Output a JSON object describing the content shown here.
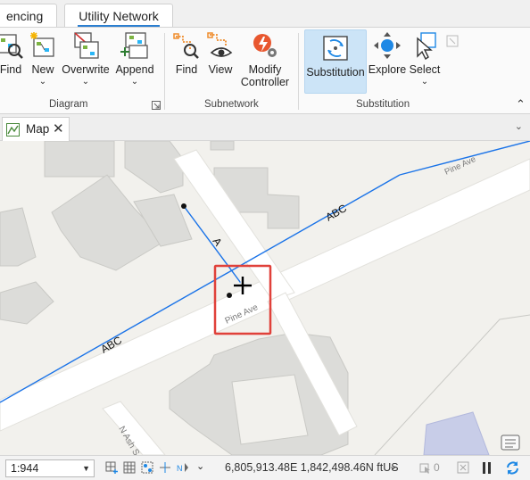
{
  "ribbon": {
    "tabs": [
      {
        "label": "encing"
      },
      {
        "label": "Utility Network"
      }
    ],
    "groups": {
      "diagram": {
        "label": "Diagram",
        "buttons": [
          {
            "label": "Find",
            "icon": "diagram-find-icon"
          },
          {
            "label": "New",
            "icon": "diagram-new-icon",
            "has_dropdown": true
          },
          {
            "label": "Overwrite",
            "icon": "diagram-overwrite-icon",
            "has_dropdown": true
          },
          {
            "label": "Append",
            "icon": "diagram-append-icon",
            "has_dropdown": true
          }
        ]
      },
      "subnetwork": {
        "label": "Subnetwork",
        "buttons": [
          {
            "label": "Find",
            "icon": "subnetwork-find-icon"
          },
          {
            "label": "View",
            "icon": "subnetwork-view-icon"
          },
          {
            "label": "Modify Controller",
            "label_line1": "Modify",
            "label_line2": "Controller",
            "icon": "modify-controller-icon"
          }
        ]
      },
      "substitution": {
        "label": "Substitution",
        "buttons": [
          {
            "label": "Substitution",
            "icon": "substitution-icon",
            "selected": true
          },
          {
            "label": "Explore",
            "icon": "explore-icon"
          },
          {
            "label": "Select",
            "icon": "select-icon",
            "has_dropdown": true
          }
        ]
      }
    }
  },
  "map_tab": {
    "label": "Map"
  },
  "map": {
    "street_labels": [
      "Pine Ave",
      "Pine Ave",
      "N Ash S"
    ],
    "line_labels": [
      "ABC",
      "ABC",
      "A"
    ],
    "colors": {
      "background": "#f2f1ed",
      "building": "#dcdcd9",
      "road": "#ffffff",
      "line": "#1a73e8",
      "highlight": "#e0413a",
      "water": "#c8cde8"
    }
  },
  "status_bar": {
    "scale": "1:944",
    "coordinates": "6,805,913.48E 1,842,498.46N ftUS",
    "selected_count": "0"
  }
}
